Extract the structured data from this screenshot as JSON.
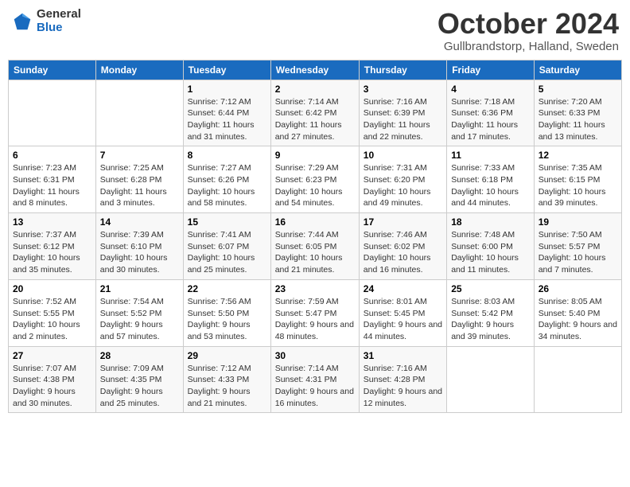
{
  "logo": {
    "general": "General",
    "blue": "Blue"
  },
  "title": "October 2024",
  "location": "Gullbrandstorp, Halland, Sweden",
  "days_of_week": [
    "Sunday",
    "Monday",
    "Tuesday",
    "Wednesday",
    "Thursday",
    "Friday",
    "Saturday"
  ],
  "weeks": [
    [
      {
        "day": "",
        "sunrise": "",
        "sunset": "",
        "daylight": ""
      },
      {
        "day": "",
        "sunrise": "",
        "sunset": "",
        "daylight": ""
      },
      {
        "day": "1",
        "sunrise": "Sunrise: 7:12 AM",
        "sunset": "Sunset: 6:44 PM",
        "daylight": "Daylight: 11 hours and 31 minutes."
      },
      {
        "day": "2",
        "sunrise": "Sunrise: 7:14 AM",
        "sunset": "Sunset: 6:42 PM",
        "daylight": "Daylight: 11 hours and 27 minutes."
      },
      {
        "day": "3",
        "sunrise": "Sunrise: 7:16 AM",
        "sunset": "Sunset: 6:39 PM",
        "daylight": "Daylight: 11 hours and 22 minutes."
      },
      {
        "day": "4",
        "sunrise": "Sunrise: 7:18 AM",
        "sunset": "Sunset: 6:36 PM",
        "daylight": "Daylight: 11 hours and 17 minutes."
      },
      {
        "day": "5",
        "sunrise": "Sunrise: 7:20 AM",
        "sunset": "Sunset: 6:33 PM",
        "daylight": "Daylight: 11 hours and 13 minutes."
      }
    ],
    [
      {
        "day": "6",
        "sunrise": "Sunrise: 7:23 AM",
        "sunset": "Sunset: 6:31 PM",
        "daylight": "Daylight: 11 hours and 8 minutes."
      },
      {
        "day": "7",
        "sunrise": "Sunrise: 7:25 AM",
        "sunset": "Sunset: 6:28 PM",
        "daylight": "Daylight: 11 hours and 3 minutes."
      },
      {
        "day": "8",
        "sunrise": "Sunrise: 7:27 AM",
        "sunset": "Sunset: 6:26 PM",
        "daylight": "Daylight: 10 hours and 58 minutes."
      },
      {
        "day": "9",
        "sunrise": "Sunrise: 7:29 AM",
        "sunset": "Sunset: 6:23 PM",
        "daylight": "Daylight: 10 hours and 54 minutes."
      },
      {
        "day": "10",
        "sunrise": "Sunrise: 7:31 AM",
        "sunset": "Sunset: 6:20 PM",
        "daylight": "Daylight: 10 hours and 49 minutes."
      },
      {
        "day": "11",
        "sunrise": "Sunrise: 7:33 AM",
        "sunset": "Sunset: 6:18 PM",
        "daylight": "Daylight: 10 hours and 44 minutes."
      },
      {
        "day": "12",
        "sunrise": "Sunrise: 7:35 AM",
        "sunset": "Sunset: 6:15 PM",
        "daylight": "Daylight: 10 hours and 39 minutes."
      }
    ],
    [
      {
        "day": "13",
        "sunrise": "Sunrise: 7:37 AM",
        "sunset": "Sunset: 6:12 PM",
        "daylight": "Daylight: 10 hours and 35 minutes."
      },
      {
        "day": "14",
        "sunrise": "Sunrise: 7:39 AM",
        "sunset": "Sunset: 6:10 PM",
        "daylight": "Daylight: 10 hours and 30 minutes."
      },
      {
        "day": "15",
        "sunrise": "Sunrise: 7:41 AM",
        "sunset": "Sunset: 6:07 PM",
        "daylight": "Daylight: 10 hours and 25 minutes."
      },
      {
        "day": "16",
        "sunrise": "Sunrise: 7:44 AM",
        "sunset": "Sunset: 6:05 PM",
        "daylight": "Daylight: 10 hours and 21 minutes."
      },
      {
        "day": "17",
        "sunrise": "Sunrise: 7:46 AM",
        "sunset": "Sunset: 6:02 PM",
        "daylight": "Daylight: 10 hours and 16 minutes."
      },
      {
        "day": "18",
        "sunrise": "Sunrise: 7:48 AM",
        "sunset": "Sunset: 6:00 PM",
        "daylight": "Daylight: 10 hours and 11 minutes."
      },
      {
        "day": "19",
        "sunrise": "Sunrise: 7:50 AM",
        "sunset": "Sunset: 5:57 PM",
        "daylight": "Daylight: 10 hours and 7 minutes."
      }
    ],
    [
      {
        "day": "20",
        "sunrise": "Sunrise: 7:52 AM",
        "sunset": "Sunset: 5:55 PM",
        "daylight": "Daylight: 10 hours and 2 minutes."
      },
      {
        "day": "21",
        "sunrise": "Sunrise: 7:54 AM",
        "sunset": "Sunset: 5:52 PM",
        "daylight": "Daylight: 9 hours and 57 minutes."
      },
      {
        "day": "22",
        "sunrise": "Sunrise: 7:56 AM",
        "sunset": "Sunset: 5:50 PM",
        "daylight": "Daylight: 9 hours and 53 minutes."
      },
      {
        "day": "23",
        "sunrise": "Sunrise: 7:59 AM",
        "sunset": "Sunset: 5:47 PM",
        "daylight": "Daylight: 9 hours and 48 minutes."
      },
      {
        "day": "24",
        "sunrise": "Sunrise: 8:01 AM",
        "sunset": "Sunset: 5:45 PM",
        "daylight": "Daylight: 9 hours and 44 minutes."
      },
      {
        "day": "25",
        "sunrise": "Sunrise: 8:03 AM",
        "sunset": "Sunset: 5:42 PM",
        "daylight": "Daylight: 9 hours and 39 minutes."
      },
      {
        "day": "26",
        "sunrise": "Sunrise: 8:05 AM",
        "sunset": "Sunset: 5:40 PM",
        "daylight": "Daylight: 9 hours and 34 minutes."
      }
    ],
    [
      {
        "day": "27",
        "sunrise": "Sunrise: 7:07 AM",
        "sunset": "Sunset: 4:38 PM",
        "daylight": "Daylight: 9 hours and 30 minutes."
      },
      {
        "day": "28",
        "sunrise": "Sunrise: 7:09 AM",
        "sunset": "Sunset: 4:35 PM",
        "daylight": "Daylight: 9 hours and 25 minutes."
      },
      {
        "day": "29",
        "sunrise": "Sunrise: 7:12 AM",
        "sunset": "Sunset: 4:33 PM",
        "daylight": "Daylight: 9 hours and 21 minutes."
      },
      {
        "day": "30",
        "sunrise": "Sunrise: 7:14 AM",
        "sunset": "Sunset: 4:31 PM",
        "daylight": "Daylight: 9 hours and 16 minutes."
      },
      {
        "day": "31",
        "sunrise": "Sunrise: 7:16 AM",
        "sunset": "Sunset: 4:28 PM",
        "daylight": "Daylight: 9 hours and 12 minutes."
      },
      {
        "day": "",
        "sunrise": "",
        "sunset": "",
        "daylight": ""
      },
      {
        "day": "",
        "sunrise": "",
        "sunset": "",
        "daylight": ""
      }
    ]
  ]
}
